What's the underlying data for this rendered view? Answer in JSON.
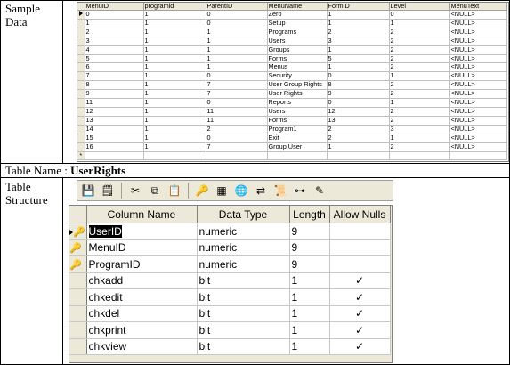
{
  "labels": {
    "sample_data": "Sample\nData",
    "table_name_prefix": "Table Name : ",
    "table_name": "UserRights",
    "table_structure": "Table\nStructure"
  },
  "sample_grid": {
    "columns": [
      "MenuID",
      "programid",
      "ParentID",
      "MenuName",
      "FormID",
      "Level",
      "MenuText"
    ],
    "rows": [
      [
        "0",
        "1",
        "0",
        "Zero",
        "1",
        "0",
        "<NULL>"
      ],
      [
        "1",
        "1",
        "0",
        "Setup",
        "1",
        "1",
        "<NULL>"
      ],
      [
        "2",
        "1",
        "1",
        "Programs",
        "2",
        "2",
        "<NULL>"
      ],
      [
        "3",
        "1",
        "1",
        "Users",
        "3",
        "2",
        "<NULL>"
      ],
      [
        "4",
        "1",
        "1",
        "Groups",
        "1",
        "2",
        "<NULL>"
      ],
      [
        "5",
        "1",
        "1",
        "Forms",
        "5",
        "2",
        "<NULL>"
      ],
      [
        "6",
        "1",
        "1",
        "Menus",
        "1",
        "2",
        "<NULL>"
      ],
      [
        "7",
        "1",
        "0",
        "Security",
        "0",
        "1",
        "<NULL>"
      ],
      [
        "8",
        "1",
        "7",
        "User Group Rights",
        "8",
        "2",
        "<NULL>"
      ],
      [
        "9",
        "1",
        "7",
        "User Rights",
        "9",
        "2",
        "<NULL>"
      ],
      [
        "11",
        "1",
        "0",
        "Reports",
        "0",
        "1",
        "<NULL>"
      ],
      [
        "12",
        "1",
        "11",
        "Users",
        "12",
        "2",
        "<NULL>"
      ],
      [
        "13",
        "1",
        "11",
        "Forms",
        "13",
        "2",
        "<NULL>"
      ],
      [
        "14",
        "1",
        "2",
        "Program1",
        "2",
        "3",
        "<NULL>"
      ],
      [
        "15",
        "1",
        "0",
        "Exit",
        "2",
        "1",
        "<NULL>"
      ],
      [
        "16",
        "1",
        "7",
        "Group User",
        "1",
        "2",
        "<NULL>"
      ]
    ],
    "new_row_marker": "*"
  },
  "toolbar": {
    "icons": [
      "save-icon",
      "properties-icon",
      "cut-icon",
      "copy-icon",
      "paste-icon",
      "primary-key-icon",
      "manage-indexes-icon",
      "manage-relationships-icon",
      "manage-constraints-icon",
      "generate-script-icon",
      "diagram-icon",
      "edit-icon"
    ],
    "glyphs": [
      "💾",
      "🗒",
      "✂",
      "⧉",
      "📋",
      "🔑",
      "▦",
      "🌐",
      "⇄",
      "📜",
      "⊶",
      "✎"
    ]
  },
  "structure_grid": {
    "columns": [
      "Column Name",
      "Data Type",
      "Length",
      "Allow Nulls"
    ],
    "rows": [
      {
        "name": "UserID",
        "type": "numeric",
        "length": "9",
        "allow_nulls": "",
        "key": true
      },
      {
        "name": "MenuID",
        "type": "numeric",
        "length": "9",
        "allow_nulls": "",
        "key": true
      },
      {
        "name": "ProgramID",
        "type": "numeric",
        "length": "9",
        "allow_nulls": "",
        "key": true
      },
      {
        "name": "chkadd",
        "type": "bit",
        "length": "1",
        "allow_nulls": "✓",
        "key": false
      },
      {
        "name": "chkedit",
        "type": "bit",
        "length": "1",
        "allow_nulls": "✓",
        "key": false
      },
      {
        "name": "chkdel",
        "type": "bit",
        "length": "1",
        "allow_nulls": "✓",
        "key": false
      },
      {
        "name": "chkprint",
        "type": "bit",
        "length": "1",
        "allow_nulls": "✓",
        "key": false
      },
      {
        "name": "chkview",
        "type": "bit",
        "length": "1",
        "allow_nulls": "✓",
        "key": false
      }
    ]
  },
  "colors": {
    "grid_header": "#ece9d8",
    "border": "#808080",
    "key": "#b8860b"
  }
}
